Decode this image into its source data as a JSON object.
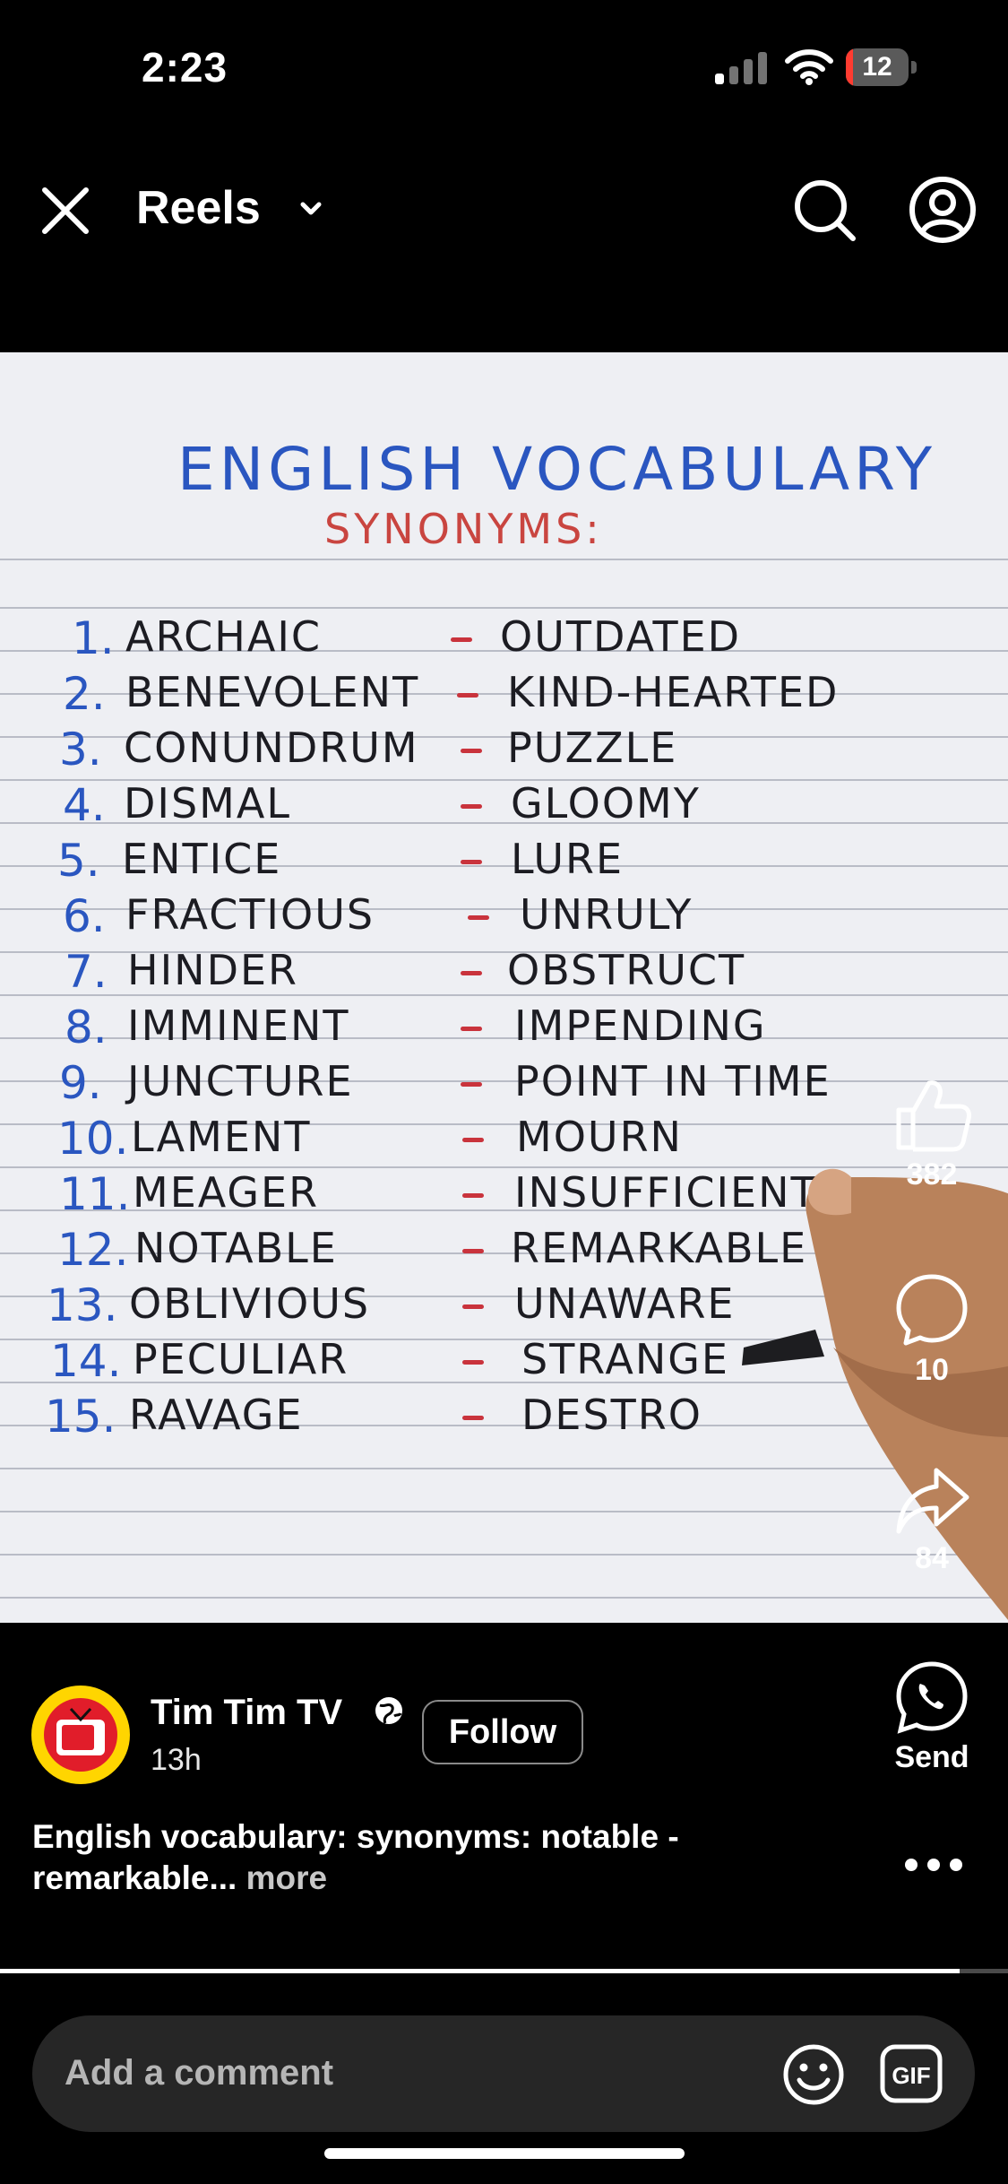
{
  "status_bar": {
    "time": "2:23",
    "battery_level": "12",
    "battery_fraction": 0.12
  },
  "header": {
    "title": "Reels"
  },
  "video": {
    "title": "ENGLISH VOCABULARY",
    "subtitle": "SYNONYMS:",
    "rows": [
      {
        "num": "1.",
        "word": "ARCHAIC",
        "synonym": "OUTDATED"
      },
      {
        "num": "2.",
        "word": "BENEVOLENT",
        "synonym": "KIND-HEARTED"
      },
      {
        "num": "3.",
        "word": "CONUNDRUM",
        "synonym": "PUZZLE"
      },
      {
        "num": "4.",
        "word": "DISMAL",
        "synonym": "GLOOMY"
      },
      {
        "num": "5.",
        "word": "ENTICE",
        "synonym": "LURE"
      },
      {
        "num": "6.",
        "word": "FRACTIOUS",
        "synonym": "UNRULY"
      },
      {
        "num": "7.",
        "word": "HINDER",
        "synonym": "OBSTRUCT"
      },
      {
        "num": "8.",
        "word": "IMMINENT",
        "synonym": "IMPENDING"
      },
      {
        "num": "9.",
        "word": "JUNCTURE",
        "synonym": "POINT IN TIME"
      },
      {
        "num": "10.",
        "word": "LAMENT",
        "synonym": "MOURN"
      },
      {
        "num": "11.",
        "word": "MEAGER",
        "synonym": "INSUFFICIENT"
      },
      {
        "num": "12.",
        "word": "NOTABLE",
        "synonym": "REMARKABLE"
      },
      {
        "num": "13.",
        "word": "OBLIVIOUS",
        "synonym": "UNAWARE"
      },
      {
        "num": "14.",
        "word": "PECULIAR",
        "synonym": "STRANGE"
      },
      {
        "num": "15.",
        "word": "RAVAGE",
        "synonym": "DESTRO"
      }
    ]
  },
  "actions": {
    "likes": "382",
    "comments": "10",
    "shares": "84",
    "send_label": "Send"
  },
  "author": {
    "name": "Tim Tim TV",
    "time": "13h",
    "follow_label": "Follow",
    "avatar_text": "Tim Tim TV"
  },
  "caption": {
    "text": "English vocabulary: synonyms: notable - remarkable...",
    "more": "more"
  },
  "playback": {
    "progress": 0.952
  },
  "comment": {
    "placeholder": "Add a comment",
    "gif_label": "GIF"
  },
  "icons": {
    "close": "close-icon",
    "chevron": "chevron-down-icon",
    "search": "search-icon",
    "profile": "profile-icon",
    "like": "heart-thumb-icon",
    "comment": "comment-bubble-icon",
    "share": "share-arrow-icon",
    "send": "whatsapp-icon",
    "globe": "globe-icon",
    "more": "more-dots-icon",
    "emoji": "emoji-icon",
    "gif": "gif-icon"
  },
  "colors": {
    "ink_blue": "#2a56c0",
    "ink_red": "#c94540",
    "ink_black": "#1c1c22",
    "paper": "#eeeff3",
    "battery_low": "#ff3b30"
  }
}
